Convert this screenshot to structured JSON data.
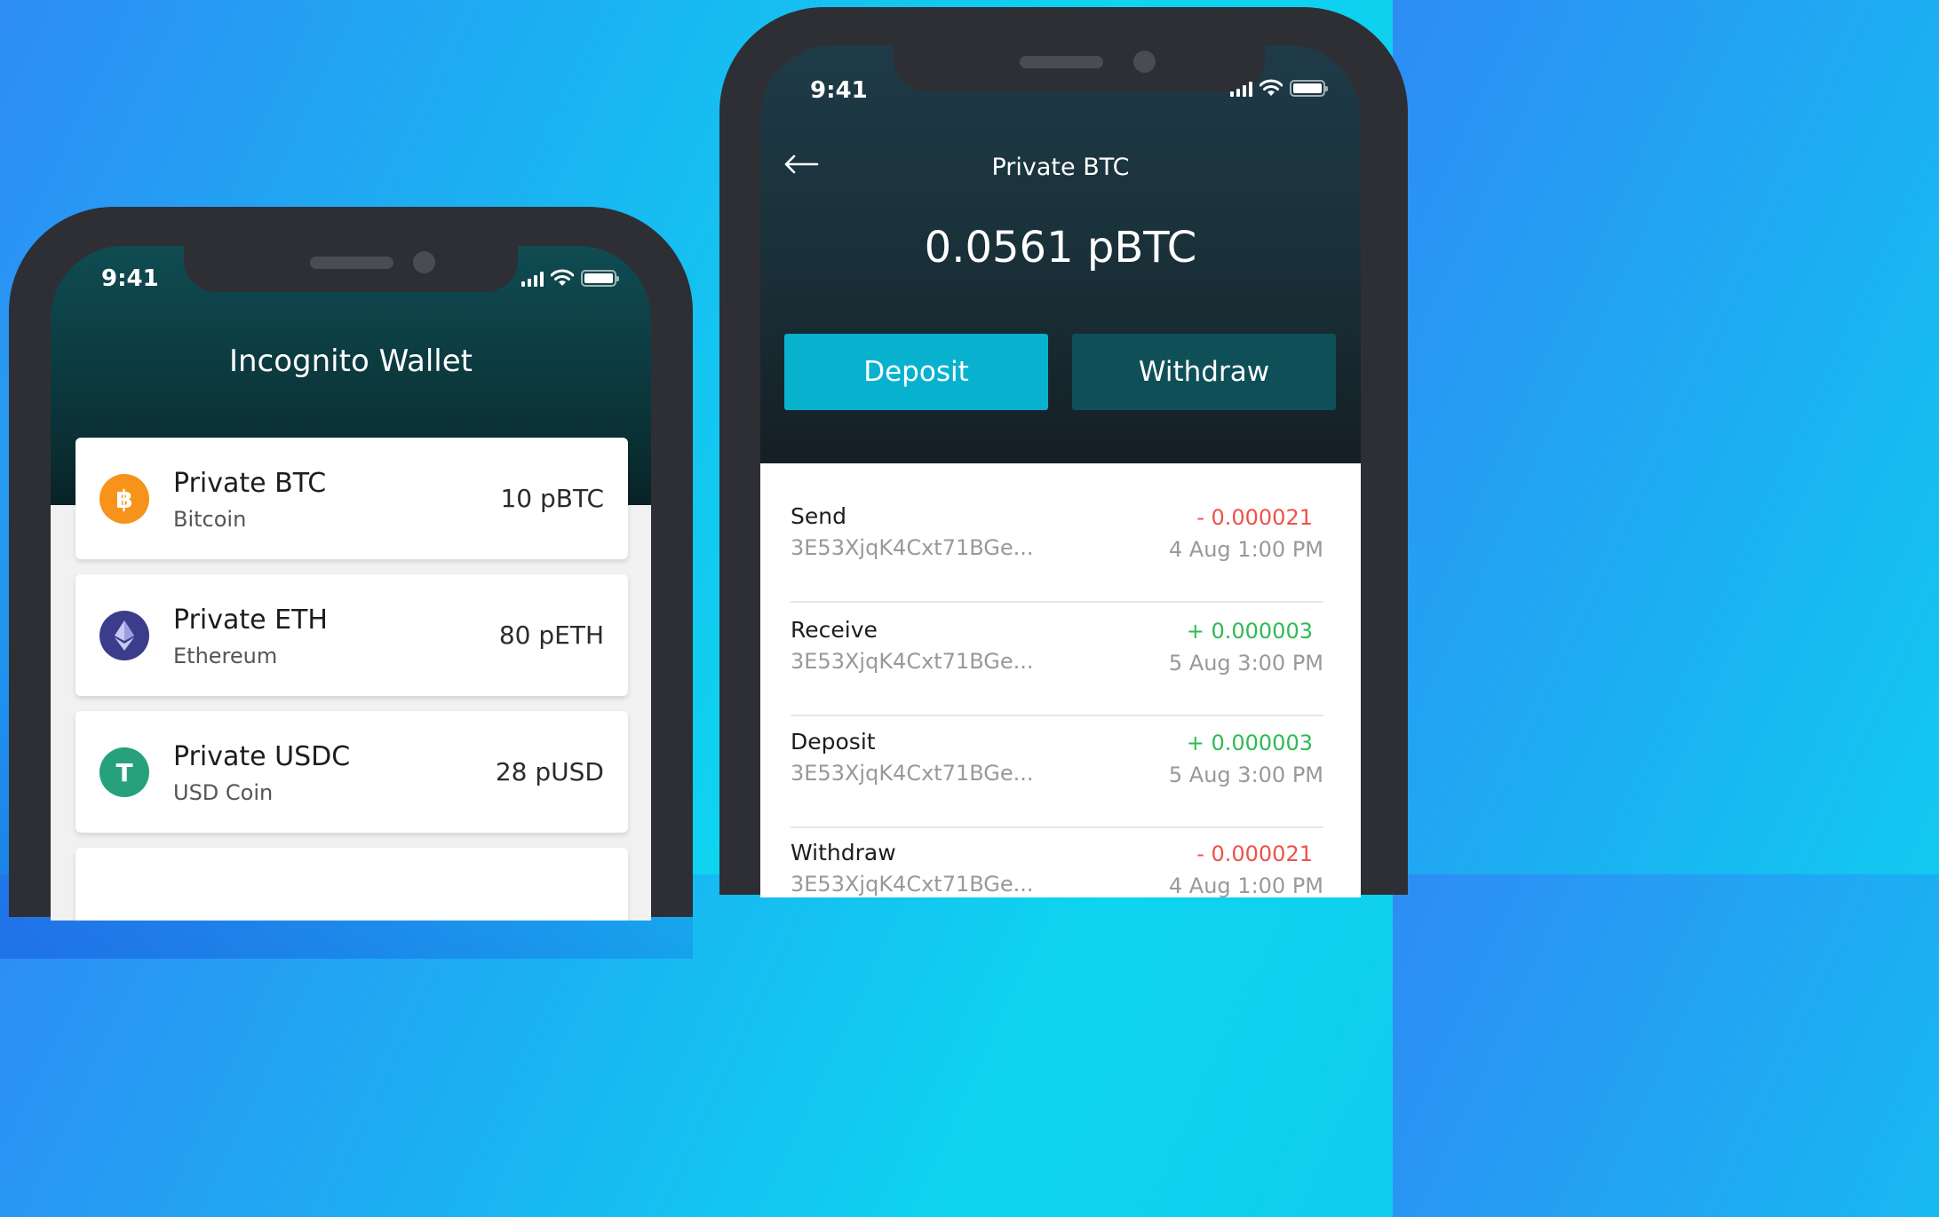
{
  "colors": {
    "deposit_button": "#08b2cf",
    "withdraw_button": "#0f4f58",
    "negative_amount": "#ef5148",
    "positive_amount": "#2dbb55",
    "btc": "#f7931a",
    "eth": "#3c3c8c",
    "usdc": "#26a17b"
  },
  "left_phone": {
    "status_time": "9:41",
    "title": "Incognito Wallet",
    "coins": [
      {
        "name": "Private BTC",
        "subtitle": "Bitcoin",
        "amount": "10 pBTC",
        "icon": "bitcoin-icon",
        "symbol": "฿"
      },
      {
        "name": "Private ETH",
        "subtitle": "Ethereum",
        "amount": "80 pETH",
        "icon": "ethereum-icon",
        "symbol": ""
      },
      {
        "name": "Private USDC",
        "subtitle": "USD Coin",
        "amount": "28 pUSD",
        "icon": "usd-coin-icon",
        "symbol": "T"
      }
    ]
  },
  "right_phone": {
    "status_time": "9:41",
    "title": "Private BTC",
    "balance": "0.0561 pBTC",
    "deposit_label": "Deposit",
    "withdraw_label": "Withdraw",
    "transactions": [
      {
        "type": "Send",
        "address": "3E53XjqK4Cxt71BGe...",
        "amount": "- 0.000021",
        "date": "4 Aug 1:00 PM"
      },
      {
        "type": "Receive",
        "address": "3E53XjqK4Cxt71BGe...",
        "amount": "+ 0.000003",
        "date": "5 Aug 3:00 PM"
      },
      {
        "type": "Deposit",
        "address": "3E53XjqK4Cxt71BGe...",
        "amount": "+ 0.000003",
        "date": "5 Aug 3:00 PM"
      },
      {
        "type": "Withdraw",
        "address": "3E53XjqK4Cxt71BGe...",
        "amount": "- 0.000021",
        "date": "4 Aug 1:00 PM"
      }
    ]
  }
}
